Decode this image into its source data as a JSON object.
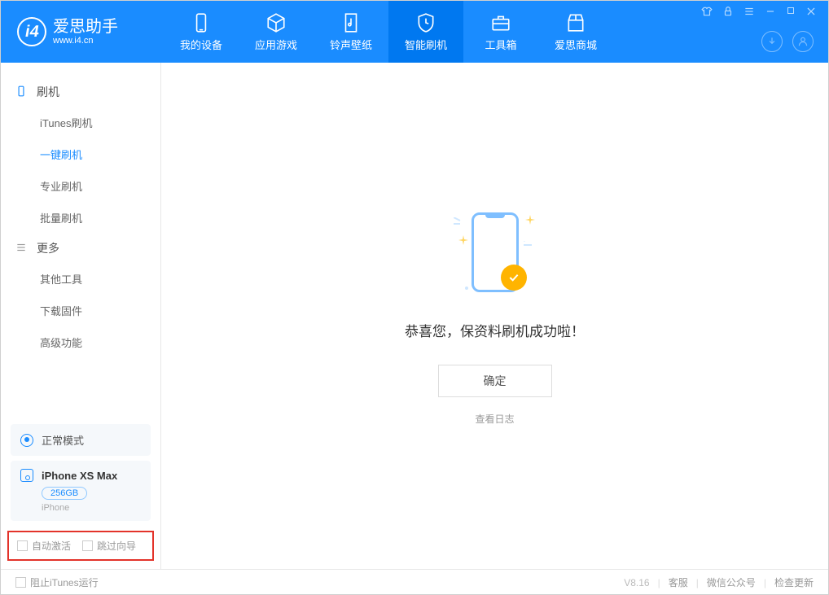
{
  "app": {
    "name": "爱思助手",
    "url": "www.i4.cn"
  },
  "nav": {
    "items": [
      {
        "label": "我的设备"
      },
      {
        "label": "应用游戏"
      },
      {
        "label": "铃声壁纸"
      },
      {
        "label": "智能刷机"
      },
      {
        "label": "工具箱"
      },
      {
        "label": "爱思商城"
      }
    ]
  },
  "sidebar": {
    "sec1_title": "刷机",
    "sec1_items": [
      "iTunes刷机",
      "一键刷机",
      "专业刷机",
      "批量刷机"
    ],
    "sec2_title": "更多",
    "sec2_items": [
      "其他工具",
      "下载固件",
      "高级功能"
    ],
    "mode": "正常模式",
    "device_name": "iPhone XS Max",
    "device_capacity": "256GB",
    "device_type": "iPhone",
    "opt_auto_activate": "自动激活",
    "opt_skip_guide": "跳过向导"
  },
  "main": {
    "success_message": "恭喜您，保资料刷机成功啦！",
    "ok_button": "确定",
    "view_log": "查看日志"
  },
  "footer": {
    "block_itunes": "阻止iTunes运行",
    "version": "V8.16",
    "support": "客服",
    "wechat": "微信公众号",
    "check_update": "检查更新"
  }
}
